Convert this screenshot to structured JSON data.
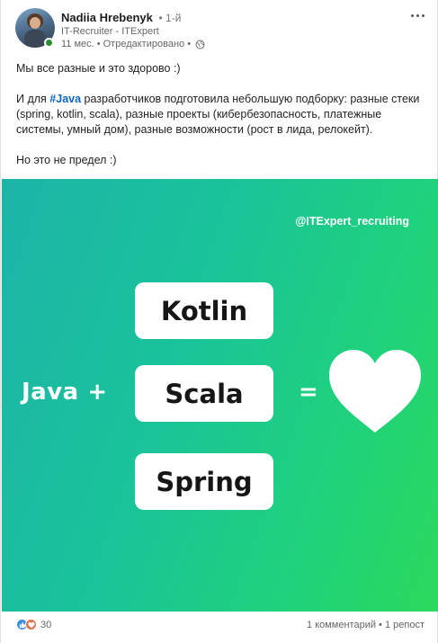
{
  "author": {
    "name": "Nadiia Hrebenyk",
    "degree": "• 1-й",
    "headline": "IT-Recruiter - ITExpert",
    "time": "11 мес.",
    "edited": "• Отредактировано •"
  },
  "post": {
    "line1": "Мы все разные и это здорово :)",
    "para2_prefix": "И для ",
    "hashtag": "#Java",
    "para2_rest": " разработчиков подготовила небольшую подборку: разные стеки (spring, kotlin, scala), разные проекты (кибербезопасность, платежные системы, умный дом), разные возможности (рост в лида, релокейт).",
    "line3": "Но это не предел :)"
  },
  "image": {
    "handle": "@ITExpert_recruiting",
    "java_plus": "Java +",
    "langs": [
      "Kotlin",
      "Scala",
      "Spring"
    ],
    "equals": "=",
    "gradient_start": "#1cb4a8",
    "gradient_end": "#2bd95b"
  },
  "footer": {
    "reaction_count": "30",
    "comments": "1 комментарий",
    "separator": " • ",
    "reposts": "1 репост"
  },
  "icons": [
    "avatar",
    "globe-icon",
    "more-icon",
    "heart-icon",
    "like-icon",
    "love-icon"
  ]
}
